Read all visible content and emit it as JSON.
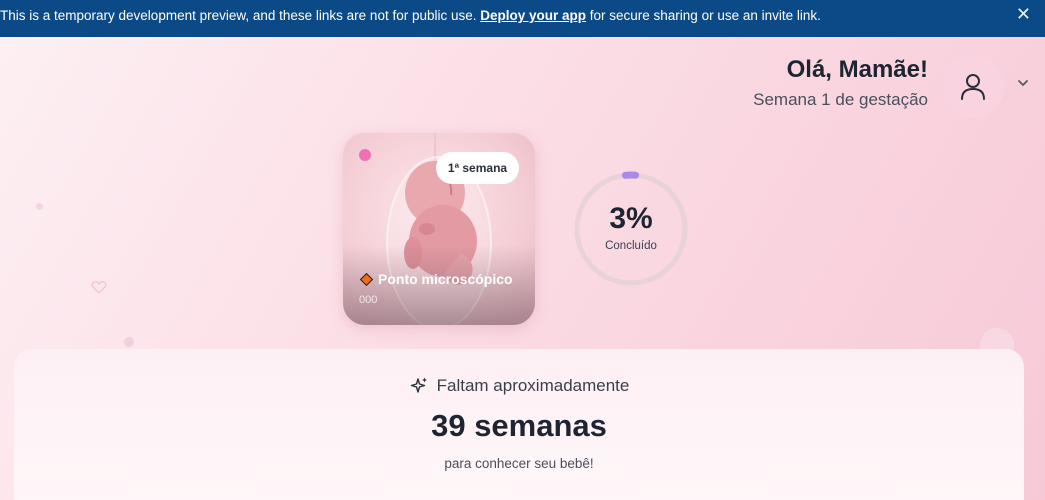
{
  "banner": {
    "message_before": "This is a temporary development preview, and these links are not for public use. ",
    "link_label": "Deploy your app",
    "message_after": " for secure sharing or use an invite link.",
    "close_label": "✕"
  },
  "header": {
    "greeting": "Olá, Mamãe!",
    "subtitle": "Semana 1 de gestação",
    "avatar_icon": "user-icon",
    "menu_icon": "chevron-down-icon"
  },
  "embryo_card": {
    "week_badge": "1ª semana",
    "stage_label": "Ponto microscópico",
    "stage_icon": "diamond-icon",
    "code": "000"
  },
  "progress": {
    "percent_label": "3%",
    "percent_value": 3,
    "caption": "Concluído",
    "color": "#a98ae6"
  },
  "countdown": {
    "heading_icon": "sparkle-icon",
    "heading": "Faltam aproximadamente",
    "value": "39 semanas",
    "subtitle": "para conhecer seu bebê!"
  }
}
